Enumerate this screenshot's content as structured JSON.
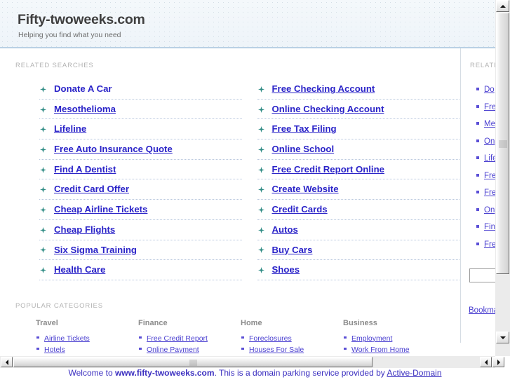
{
  "header": {
    "title": "Fifty-twoweeks.com",
    "tagline": "Helping you find what you need"
  },
  "main": {
    "related_label": "RELATED SEARCHES",
    "columns": [
      {
        "items": [
          "Donate A Car",
          "Mesothelioma",
          "Lifeline",
          "Free Auto Insurance Quote",
          "Find A Dentist",
          "Credit Card Offer",
          "Cheap Airline Tickets",
          "Cheap Flights",
          "Six Sigma Training",
          "Health Care"
        ]
      },
      {
        "items": [
          "Free Checking Account",
          "Online Checking Account",
          "Free Tax Filing",
          "Online School",
          "Free Credit Report Online",
          "Create Website",
          "Credit Cards",
          "Autos",
          "Buy Cars",
          "Shoes"
        ]
      }
    ]
  },
  "sidebar": {
    "related_label": "RELATED",
    "items": [
      "Do",
      "Fre",
      "Me",
      "On",
      "Life",
      "Fre",
      "Fre",
      "On",
      "Fin",
      "Fre"
    ],
    "search_value": "",
    "search_placeholder": "",
    "bookmark_label": "Bookmark"
  },
  "categories": {
    "label": "POPULAR CATEGORIES",
    "groups": [
      {
        "title": "Travel",
        "items": [
          "Airline Tickets",
          "Hotels"
        ]
      },
      {
        "title": "Finance",
        "items": [
          "Free Credit Report",
          "Online Payment"
        ]
      },
      {
        "title": "Home",
        "items": [
          "Foreclosures",
          "Houses For Sale"
        ]
      },
      {
        "title": "Business",
        "items": [
          "Employment",
          "Work From Home"
        ]
      }
    ]
  },
  "footer": {
    "prefix": "Welcome to ",
    "domain": "www.fifty-twoweeks.com",
    "middle": ". This is a domain parking service provided by ",
    "provider": "Active-Domain"
  },
  "icons": {
    "bullet_star": "star-bullet-icon",
    "bullet_dot": "dot-bullet-icon"
  },
  "colors": {
    "link": "#2a23c8",
    "sidebar_link": "#4a3fd0",
    "star": "#2e8b84",
    "header_bg": "#eef4f9",
    "header_rule": "#b9d0e4",
    "label": "#b3b3b3"
  }
}
